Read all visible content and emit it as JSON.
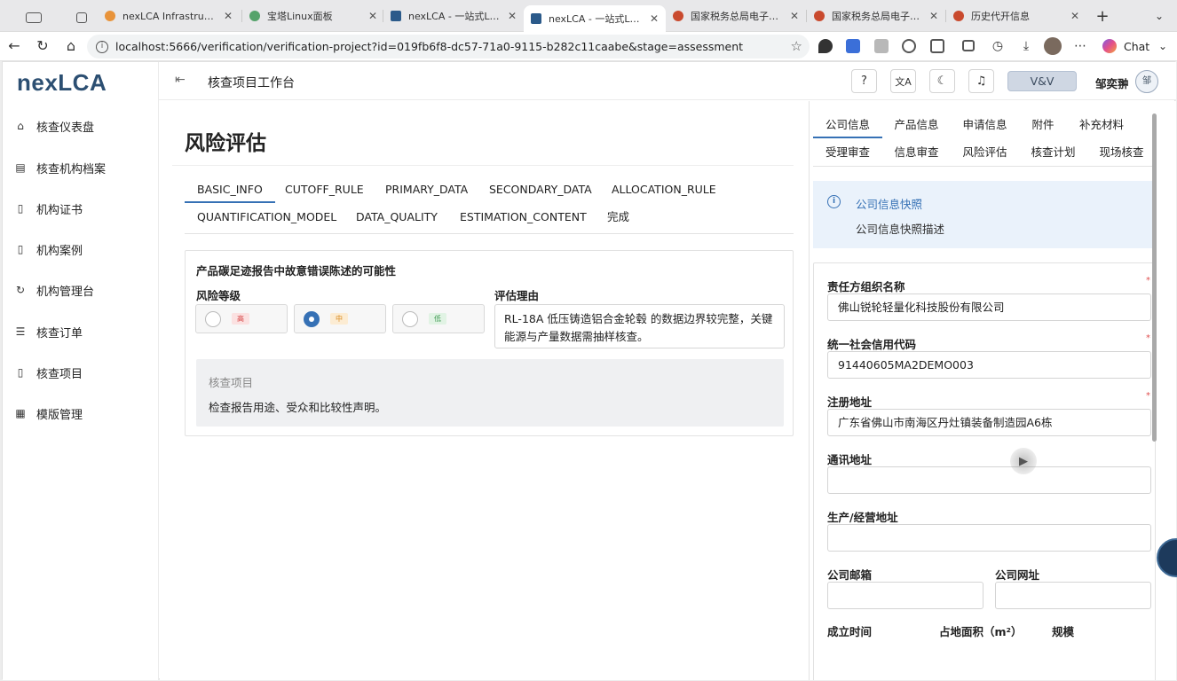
{
  "browser": {
    "tabs": [
      {
        "title": "nexLCA Infrastructure",
        "favicon_color": "#e8933a"
      },
      {
        "title": "宝塔Linux面板",
        "favicon_color": "#55a36b"
      },
      {
        "title": "nexLCA - 一站式LCA/E",
        "favicon_color": "#2b5a8a"
      },
      {
        "title": "nexLCA - 一站式LCA/E",
        "favicon_color": "#2b5a8a",
        "active": true
      },
      {
        "title": "国家税务总局电子税务局",
        "favicon_color": "#c94a2e"
      },
      {
        "title": "国家税务总局电子税务局",
        "favicon_color": "#c94a2e"
      },
      {
        "title": "历史代开信息",
        "favicon_color": "#c94a2e"
      }
    ],
    "url": "localhost:5666/verification/verification-project?id=019fb6f8-dc57-71a0-9115-b282c11caabe&stage=assessment",
    "chat_label": "Chat"
  },
  "app": {
    "logo": "nexLCA",
    "sidebar": [
      {
        "label": "核查仪表盘",
        "icon": "dashboard-icon",
        "glyph": "⌂"
      },
      {
        "label": "核查机构档案",
        "icon": "archive-icon",
        "glyph": "▤"
      },
      {
        "label": "机构证书",
        "icon": "certificate-icon",
        "glyph": "▯"
      },
      {
        "label": "机构案例",
        "icon": "case-icon",
        "glyph": "▯"
      },
      {
        "label": "机构管理台",
        "icon": "console-icon",
        "glyph": "↻"
      },
      {
        "label": "核查订单",
        "icon": "list-icon",
        "glyph": "☰"
      },
      {
        "label": "核查项目",
        "icon": "project-icon",
        "glyph": "▯"
      },
      {
        "label": "模版管理",
        "icon": "template-icon",
        "glyph": "▦"
      }
    ],
    "header": {
      "title": "核查项目工作台",
      "role_badge": "V&V",
      "user_name": "邹奕翀",
      "avatar_text": "邹",
      "help": "?",
      "translate": "文A"
    },
    "main": {
      "page_title": "风险评估",
      "steps": [
        "BASIC_INFO",
        "CUTOFF_RULE",
        "PRIMARY_DATA",
        "SECONDARY_DATA",
        "ALLOCATION_RULE",
        "QUANTIFICATION_MODEL",
        "DATA_QUALITY",
        "ESTIMATION_CONTENT",
        "完成"
      ],
      "active_step": "BASIC_INFO",
      "question": "产品碳足迹报告中故意错误陈述的可能性",
      "risk_label": "风险等级",
      "risk_options": [
        {
          "label": "高",
          "color": "#d64545",
          "bg": "#fbe1e1"
        },
        {
          "label": "中",
          "color": "#d88a1f",
          "bg": "#fcecd3"
        },
        {
          "label": "低",
          "color": "#3f9a52",
          "bg": "#e1f3e4"
        }
      ],
      "risk_selected": "中",
      "reason_label": "评估理由",
      "reason_text": "RL-18A 低压铸造铝合金轮毂 的数据边界较完整，关键能源与产量数据需抽样核查。",
      "hint_title": "核查项目",
      "hint_text": "检查报告用途、受众和比较性声明。"
    },
    "right_panel": {
      "tabs_row1": [
        "公司信息",
        "产品信息",
        "申请信息",
        "附件",
        "补充材料"
      ],
      "tabs_row2": [
        "受理审查",
        "信息审查",
        "风险评估",
        "核查计划",
        "现场核查"
      ],
      "active_tab": "公司信息",
      "info_title": "公司信息快照",
      "info_desc": "公司信息快照描述",
      "fields": {
        "org_name_label": "责任方组织名称",
        "org_name_value": "佛山锐轮轻量化科技股份有限公司",
        "credit_code_label": "统一社会信用代码",
        "credit_code_value": "91440605MA2DEMO003",
        "reg_address_label": "注册地址",
        "reg_address_value": "广东省佛山市南海区丹灶镇装备制造园A6栋",
        "mail_address_label": "通讯地址",
        "mail_address_value": "",
        "prod_address_label": "生产/经营地址",
        "prod_address_value": "",
        "email_label": "公司邮箱",
        "email_value": "",
        "website_label": "公司网址",
        "website_value": "",
        "founded_label": "成立时间",
        "area_label": "占地面积（m²）",
        "scale_label": "规模",
        "required_mark": "*"
      }
    }
  }
}
